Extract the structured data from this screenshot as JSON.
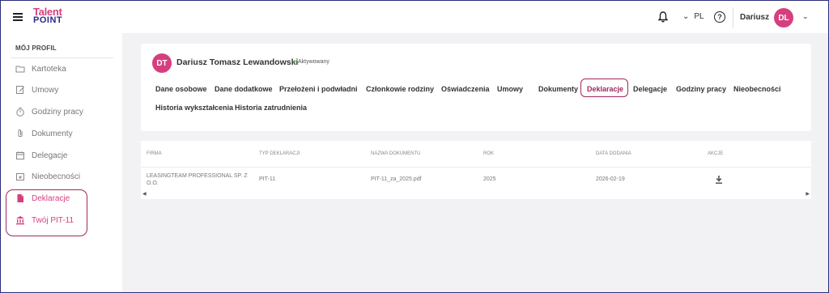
{
  "app": {
    "logo_top": "Talent",
    "logo_bottom": "POINT"
  },
  "header": {
    "language": "PL",
    "user_name": "Dariusz",
    "user_initials": "DL"
  },
  "sidebar": {
    "title": "MÓJ PROFIL",
    "items": [
      {
        "label": "Kartoteka",
        "icon": "folder-icon"
      },
      {
        "label": "Umowy",
        "icon": "contract-edit-icon"
      },
      {
        "label": "Godziny pracy",
        "icon": "stopwatch-icon"
      },
      {
        "label": "Dokumenty",
        "icon": "paperclip-icon"
      },
      {
        "label": "Delegacje",
        "icon": "calendar-icon"
      },
      {
        "label": "Nieobecności",
        "icon": "calendar-x-icon"
      },
      {
        "label": "Deklaracje",
        "icon": "document-icon"
      },
      {
        "label": "Twój PIT-11",
        "icon": "bank-icon"
      }
    ]
  },
  "employee": {
    "initials": "DT",
    "name": "Dariusz Tomasz Lewandowski",
    "status": "Aktywowany"
  },
  "tabs": [
    "Dane osobowe",
    "Dane dodatkowe",
    "Przełożeni i podwładni",
    "Członkowie rodziny",
    "Oświadczenia",
    "Umowy",
    "Dokumenty",
    "Deklaracje",
    "Delegacje",
    "Godziny pracy",
    "Nieobecności",
    "Historia wykształcenia",
    "Historia zatrudnienia"
  ],
  "active_tab": "Deklaracje",
  "table": {
    "headers": [
      "FIRMA",
      "TYP DEKLARACJI",
      "NAZWA DOKUMENTU",
      "ROK",
      "DATA DODANIA",
      "AKCJE"
    ],
    "rows": [
      {
        "firma_line1": "LEASINGTEAM PROFESSIONAL SP. Z",
        "firma_line2": "O.O.",
        "typ": "PIT-11",
        "nazwa": "PIT-11_za_2025.pdf",
        "rok": "2025",
        "data": "2026-02-19",
        "akcja_icon": "download-icon"
      }
    ]
  },
  "colors": {
    "accent": "#d63f7f",
    "brand_dark": "#2b2a8f",
    "highlight": "#a0285f"
  }
}
